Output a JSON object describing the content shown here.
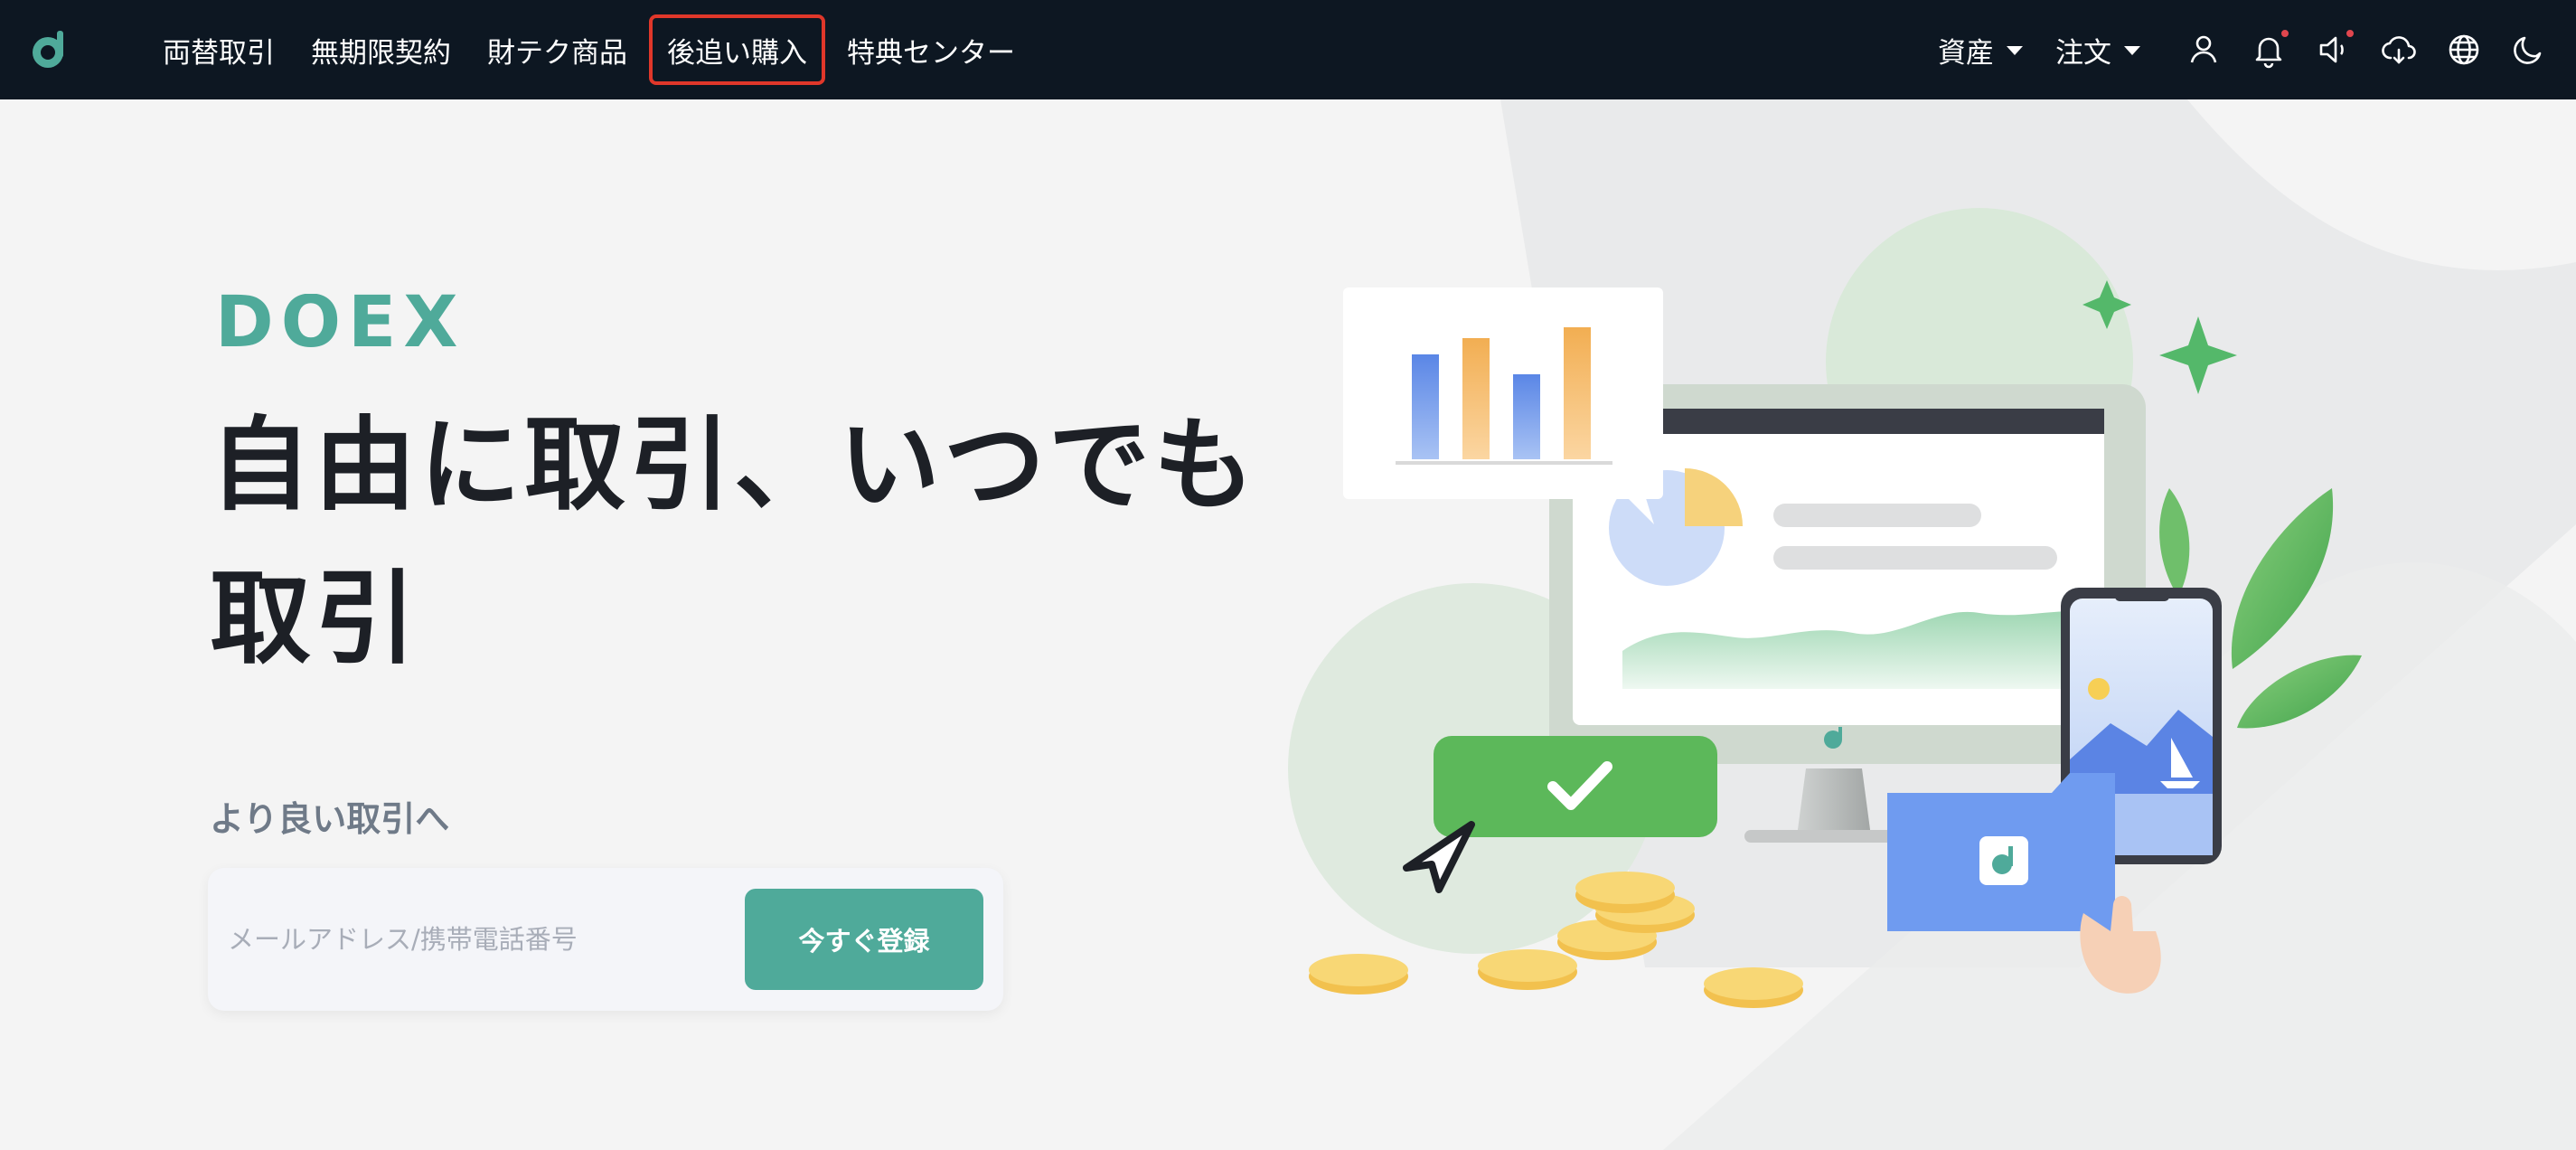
{
  "nav": {
    "items": [
      {
        "label": "両替取引"
      },
      {
        "label": "無期限契約"
      },
      {
        "label": "財テク商品"
      },
      {
        "label": "後追い購入"
      },
      {
        "label": "特典センター"
      }
    ],
    "right": {
      "assets_label": "資産",
      "orders_label": "注文"
    }
  },
  "hero": {
    "brand": "DOEX",
    "title_line1": "自由に取引、いつでも",
    "title_line2": "取引",
    "subtitle": "より良い取引へ",
    "input_placeholder": "メールアドレス/携帯電話番号",
    "register_label": "今すぐ登録"
  },
  "colors": {
    "navbar": "#0d1722",
    "accent": "#4faa9a",
    "brand_green": "#4faa9a",
    "active_outline": "#e0372a",
    "notification_dot": "#e0464e"
  },
  "icons": [
    "app-logo-icon",
    "user-icon",
    "bell-icon",
    "speaker-icon",
    "cloud-download-icon",
    "globe-icon",
    "moon-icon"
  ]
}
